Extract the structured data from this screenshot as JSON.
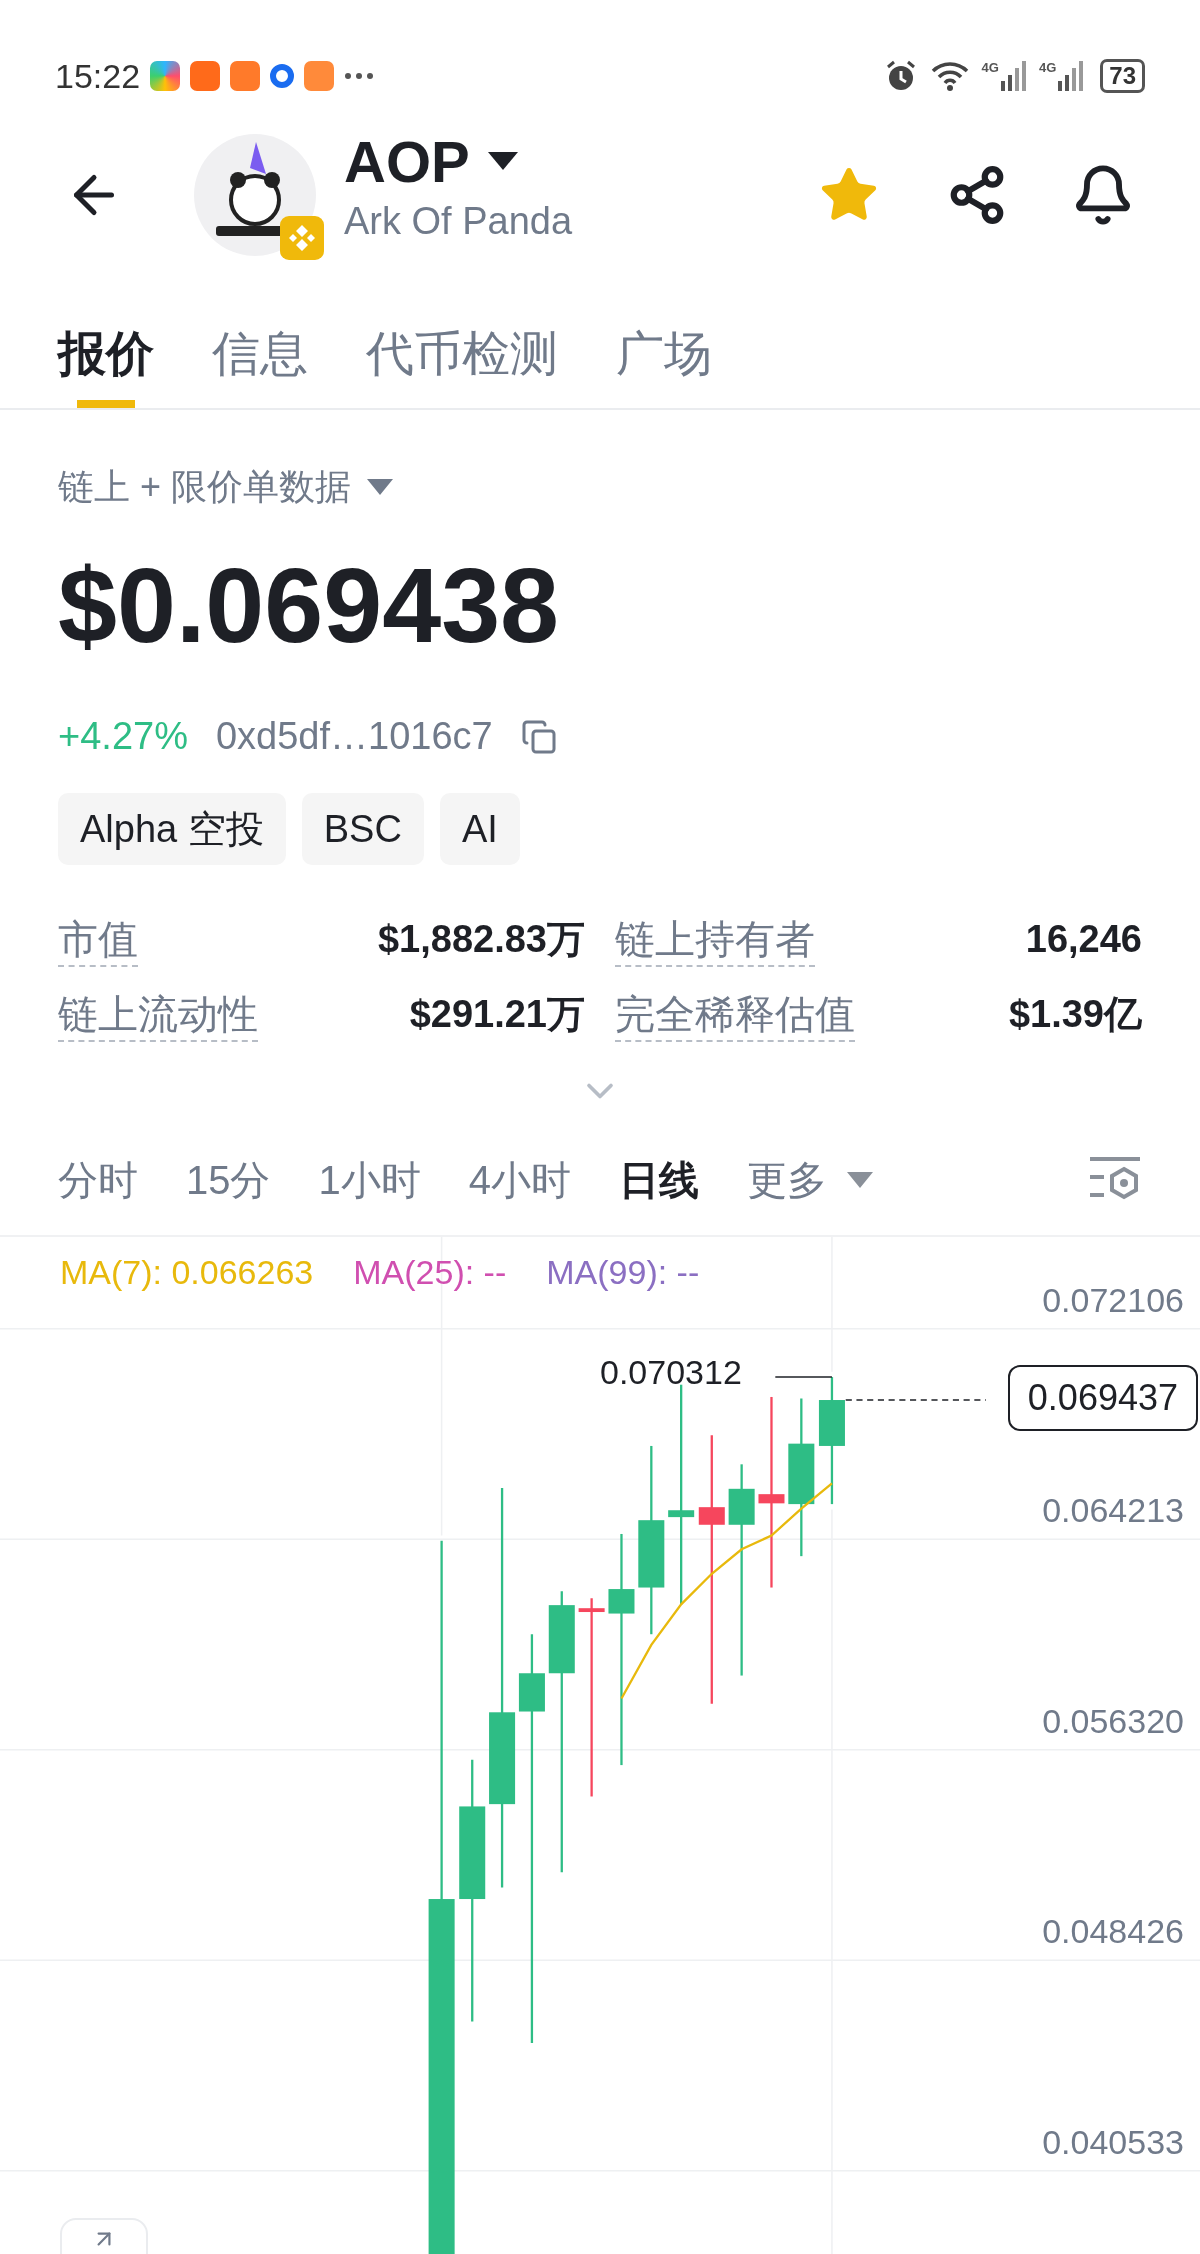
{
  "status_bar": {
    "time": "15:22",
    "network": [
      "4G",
      "4G"
    ],
    "battery": "73"
  },
  "header": {
    "symbol": "AOP",
    "name": "Ark Of Panda",
    "favorite": true
  },
  "tabs": [
    {
      "label": "报价",
      "selected": true
    },
    {
      "label": "信息",
      "selected": false
    },
    {
      "label": "代币检测",
      "selected": false
    },
    {
      "label": "广场",
      "selected": false
    }
  ],
  "source_selector": "链上 + 限价单数据",
  "price": "$0.069438",
  "change": "+4.27%",
  "address": "0xd5df…1016c7",
  "tags": [
    "Alpha 空投",
    "BSC",
    "AI"
  ],
  "stats": [
    {
      "label": "市值",
      "value": "$1,882.83万"
    },
    {
      "label": "链上持有者",
      "value": "16,246"
    },
    {
      "label": "链上流动性",
      "value": "$291.21万"
    },
    {
      "label": "完全稀释估值",
      "value": "$1.39亿"
    }
  ],
  "timeframes": [
    {
      "label": "分时",
      "selected": false,
      "kind": "tab"
    },
    {
      "label": "15分",
      "selected": false,
      "kind": "tab"
    },
    {
      "label": "1小时",
      "selected": false,
      "kind": "tab"
    },
    {
      "label": "4小时",
      "selected": false,
      "kind": "tab"
    },
    {
      "label": "日线",
      "selected": true,
      "kind": "tab"
    },
    {
      "label": "更多",
      "selected": false,
      "kind": "dropdown"
    }
  ],
  "chart": {
    "ma_legend": [
      {
        "text": "MA(7): 0.066263",
        "color": "#e8b90c"
      },
      {
        "text": "MA(25): --",
        "color": "#d04fb0"
      },
      {
        "text": "MA(99): --",
        "color": "#8b6fc2"
      }
    ],
    "axis_labels": [
      "0.072106",
      "0.064213",
      "0.056320",
      "0.048426",
      "0.040533"
    ],
    "high_label": "0.070312",
    "last_price": "0.069437"
  }
}
